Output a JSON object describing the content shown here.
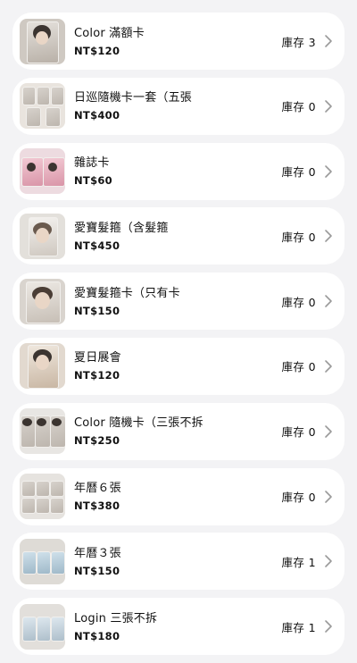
{
  "products": [
    {
      "name": "Color 滿額卡",
      "price": "NT$120",
      "stock": "庫存 3",
      "thumb": "single-photocard-icon"
    },
    {
      "name": "日巡隨機卡一套（五張",
      "price": "NT$400",
      "stock": "庫存 0",
      "thumb": "photocard-set-icon"
    },
    {
      "name": "雜誌卡",
      "price": "NT$60",
      "stock": "庫存 0",
      "thumb": "magazine-card-icon"
    },
    {
      "name": "愛寶髮箍（含髮箍",
      "price": "NT$450",
      "stock": "庫存 0",
      "thumb": "headband-photo-icon"
    },
    {
      "name": "愛寶髮箍卡（只有卡",
      "price": "NT$150",
      "stock": "庫存 0",
      "thumb": "headband-card-icon"
    },
    {
      "name": "夏日展會",
      "price": "NT$120",
      "stock": "庫存 0",
      "thumb": "summer-event-card-icon"
    },
    {
      "name": "Color 隨機卡（三張不拆",
      "price": "NT$250",
      "stock": "庫存 0",
      "thumb": "three-card-set-icon"
    },
    {
      "name": "年曆６張",
      "price": "NT$380",
      "stock": "庫存 0",
      "thumb": "calendar-six-icon"
    },
    {
      "name": "年曆３張",
      "price": "NT$150",
      "stock": "庫存 1",
      "thumb": "calendar-three-icon"
    },
    {
      "name": "Login 三張不拆",
      "price": "NT$180",
      "stock": "庫存 1",
      "thumb": "login-card-set-icon"
    }
  ],
  "icons": {
    "chevron": "chevron-right-icon"
  },
  "colors": {
    "background": "#f3f3f5",
    "card": "#ffffff",
    "text": "#111111",
    "chevron": "#9a9a9a"
  }
}
